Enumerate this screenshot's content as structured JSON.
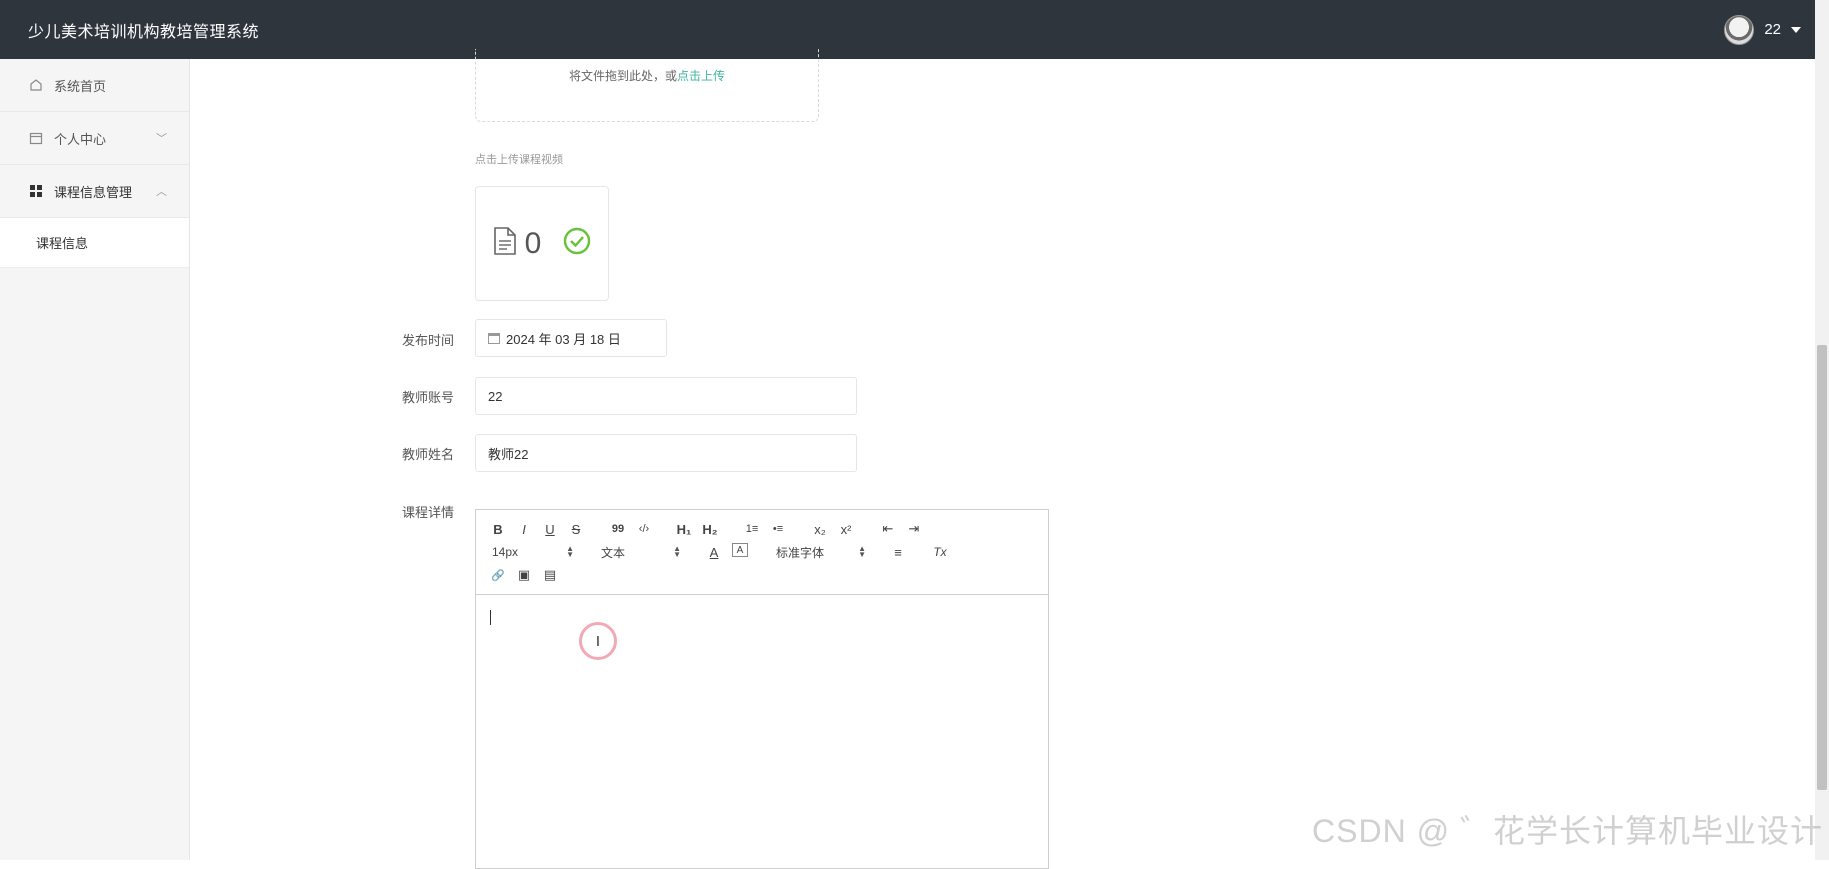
{
  "header": {
    "title": "少儿美术培训机构教培管理系统",
    "username": "22"
  },
  "sidebar": {
    "items": [
      {
        "label": "系统首页",
        "icon": "home-icon"
      },
      {
        "label": "个人中心",
        "icon": "calendar-icon",
        "chevron": "﹀"
      },
      {
        "label": "课程信息管理",
        "icon": "grid-icon",
        "chevron": "︿"
      }
    ],
    "subitems": [
      {
        "label": "课程信息"
      }
    ]
  },
  "upload": {
    "drop_text": "将文件拖到此处，或",
    "drop_link": "点击上传",
    "hint": "点击上传课程视频",
    "file_count": "0"
  },
  "form": {
    "publish_time_label": "发布时间",
    "publish_time_value": "2024 年 03 月 18 日",
    "teacher_account_label": "教师账号",
    "teacher_account_value": "22",
    "teacher_name_label": "教师姓名",
    "teacher_name_value": "教师22",
    "details_label": "课程详情"
  },
  "editor": {
    "font_size": "14px",
    "header_select": "文本",
    "font_family": "标准字体",
    "buttons": {
      "bold": "B",
      "italic": "I",
      "underline": "U",
      "strike": "S",
      "quote": "99",
      "code": "‹/›",
      "h1": "H₁",
      "h2": "H₂",
      "ol": "1≡",
      "ul": "•≡",
      "sub": "x₂",
      "sup": "x²",
      "outdent": "⇤",
      "indent": "⇥",
      "color": "A",
      "background": "A",
      "align": "≡",
      "clean": "Tx",
      "link": "🔗",
      "image": "▣",
      "video": "▤"
    },
    "cursor_glyph": "I"
  },
  "watermark": "CSDN @ ゛花学长计算机毕业设计",
  "colors": {
    "header_bg": "#2f353d",
    "accent": "#3fb6a0",
    "success": "#67c23a"
  }
}
